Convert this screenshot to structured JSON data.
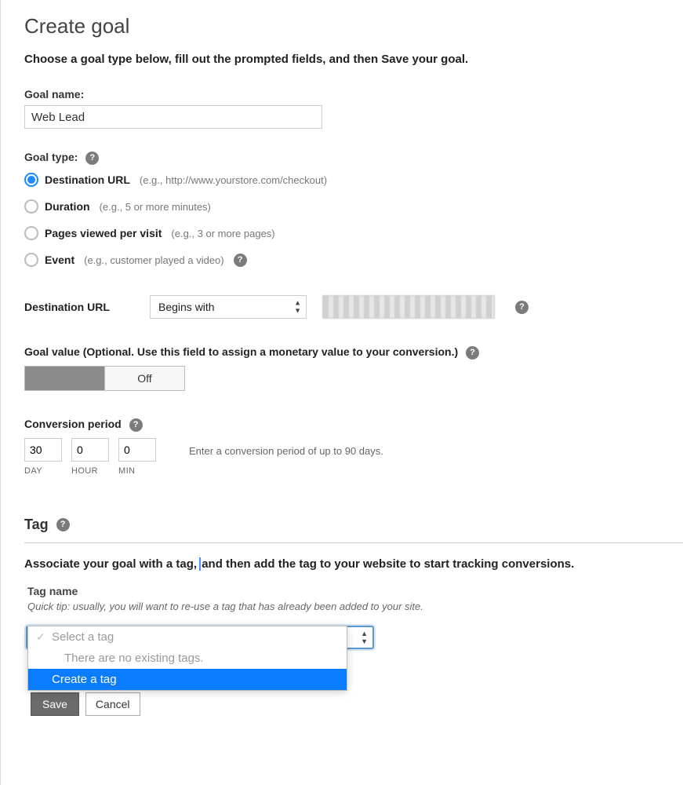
{
  "page": {
    "title": "Create goal",
    "intro": "Choose a goal type below, fill out the prompted fields, and then Save your goal."
  },
  "goal_name": {
    "label": "Goal name:",
    "value": "Web Lead"
  },
  "goal_type": {
    "label": "Goal type:",
    "options": [
      {
        "id": "destination",
        "label": "Destination URL",
        "hint": "(e.g., http://www.yourstore.com/checkout)",
        "checked": true
      },
      {
        "id": "duration",
        "label": "Duration",
        "hint": "(e.g., 5 or more minutes)",
        "checked": false
      },
      {
        "id": "pages",
        "label": "Pages viewed per visit",
        "hint": "(e.g., 3 or more pages)",
        "checked": false
      },
      {
        "id": "event",
        "label": "Event",
        "hint": "(e.g., customer played a video)",
        "checked": false,
        "help_after": true
      }
    ]
  },
  "destination": {
    "label": "Destination URL",
    "match_type": "Begins with",
    "url_value": ""
  },
  "goal_value": {
    "label": "Goal value (Optional. Use this field to assign a monetary value to your conversion.)",
    "state_label": "Off",
    "state": "off"
  },
  "conversion_period": {
    "label": "Conversion period",
    "hint": "Enter a conversion period of up to 90 days.",
    "day": {
      "value": "30",
      "caption": "DAY"
    },
    "hour": {
      "value": "0",
      "caption": "HOUR"
    },
    "min": {
      "value": "0",
      "caption": "MIN"
    }
  },
  "tag": {
    "heading": "Tag",
    "description_part1": "Associate your goal with a tag, ",
    "description_part2": "and then add the tag to your website to start tracking conversions.",
    "name_label": "Tag name",
    "tip": "Quick tip: usually, you will want to re-use a tag that has already been added to your site.",
    "dropdown": {
      "placeholder": "Select a tag",
      "empty": "There are no existing tags.",
      "create": "Create a tag"
    }
  },
  "buttons": {
    "save": "Save",
    "cancel": "Cancel"
  }
}
